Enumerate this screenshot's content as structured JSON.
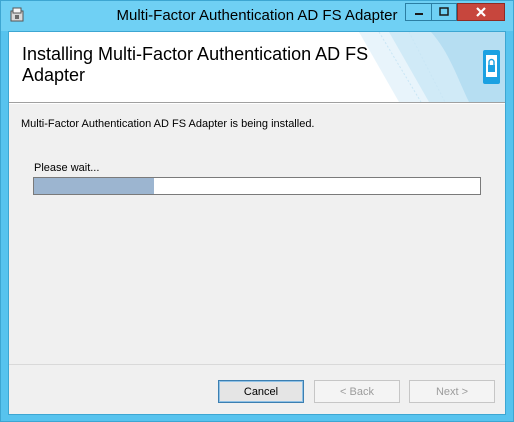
{
  "window": {
    "title": "Multi-Factor Authentication AD FS Adapter"
  },
  "banner": {
    "title": "Installing Multi-Factor Authentication AD FS Adapter"
  },
  "body": {
    "status_text": "Multi-Factor Authentication AD FS Adapter is being installed.",
    "wait_text": "Please wait...",
    "progress_fraction": 0.27
  },
  "buttons": {
    "cancel": "Cancel",
    "back": "< Back",
    "next": "Next >"
  },
  "icons": {
    "app": "installer-app-icon",
    "minimize": "minimize-icon",
    "maximize": "maximize-icon",
    "close": "close-icon",
    "banner": "phone-lock-icon"
  },
  "colors": {
    "titlebar": "#6fd0f4",
    "close_button": "#c7463d",
    "progress_fill": "#9cb5d0",
    "accent": "#1ba1e2"
  }
}
